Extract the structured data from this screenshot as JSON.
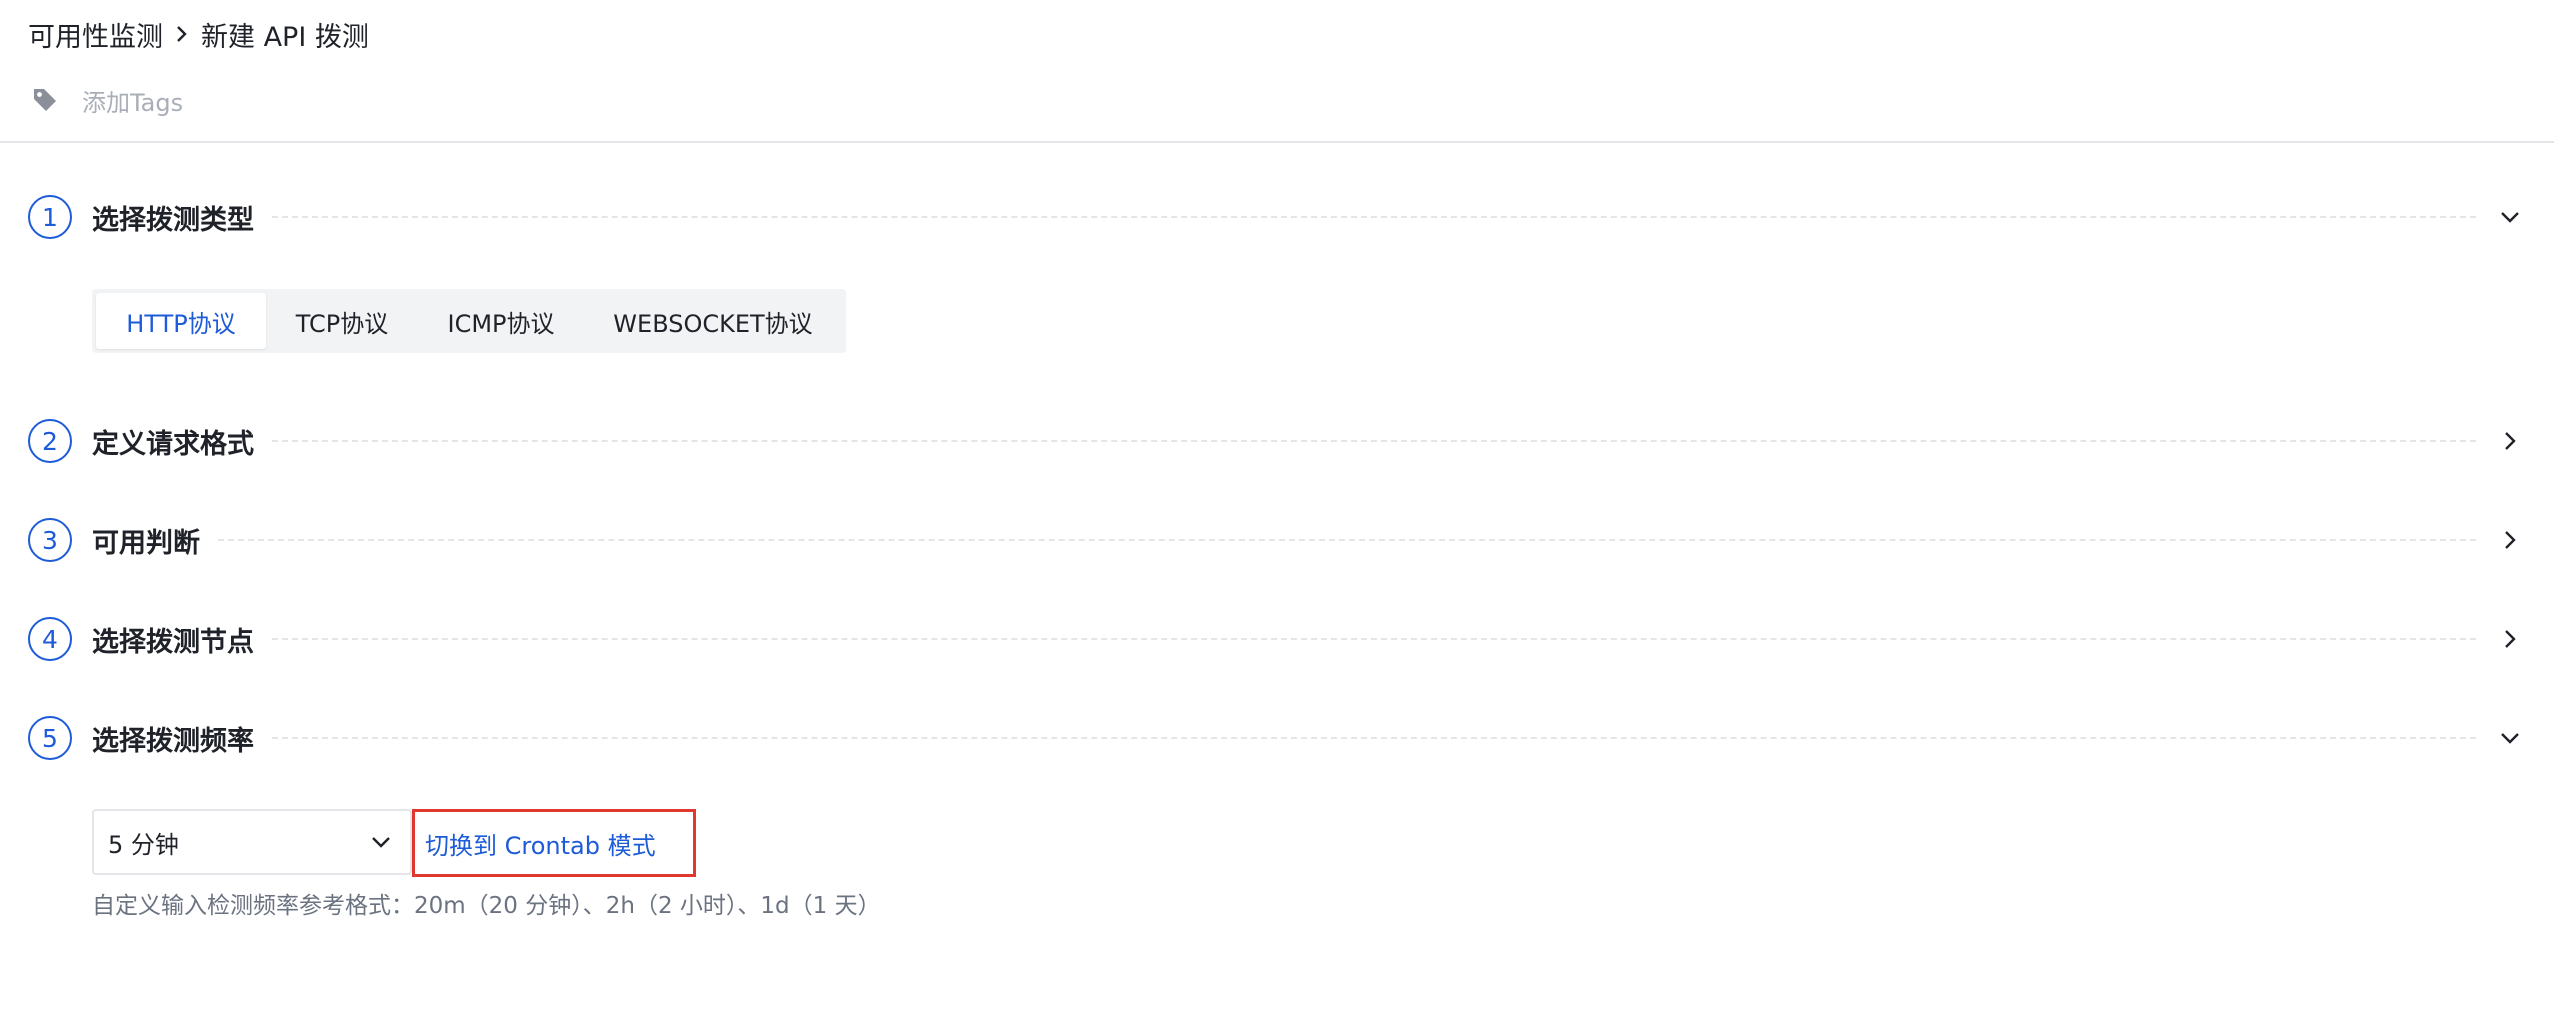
{
  "breadcrumb": {
    "parent": "可用性监测",
    "current": "新建 API 拨测"
  },
  "tags": {
    "add_label": "添加Tags"
  },
  "steps": [
    {
      "num": "1",
      "title": "选择拨测类型",
      "expanded": true
    },
    {
      "num": "2",
      "title": "定义请求格式",
      "expanded": false
    },
    {
      "num": "3",
      "title": "可用判断",
      "expanded": false
    },
    {
      "num": "4",
      "title": "选择拨测节点",
      "expanded": false
    },
    {
      "num": "5",
      "title": "选择拨测频率",
      "expanded": true
    }
  ],
  "protocols": {
    "options": [
      "HTTP协议",
      "TCP协议",
      "ICMP协议",
      "WEBSOCKET协议"
    ],
    "selected": "HTTP协议"
  },
  "frequency": {
    "selected": "5 分钟",
    "switch_link": "切换到 Crontab 模式",
    "hint": "自定义输入检测频率参考格式：20m（20 分钟）、2h（2 小时）、1d（1 天）"
  },
  "colors": {
    "accent": "#1d5bd8",
    "highlight_border": "#e0382e",
    "muted_text": "#a9aeb8"
  }
}
